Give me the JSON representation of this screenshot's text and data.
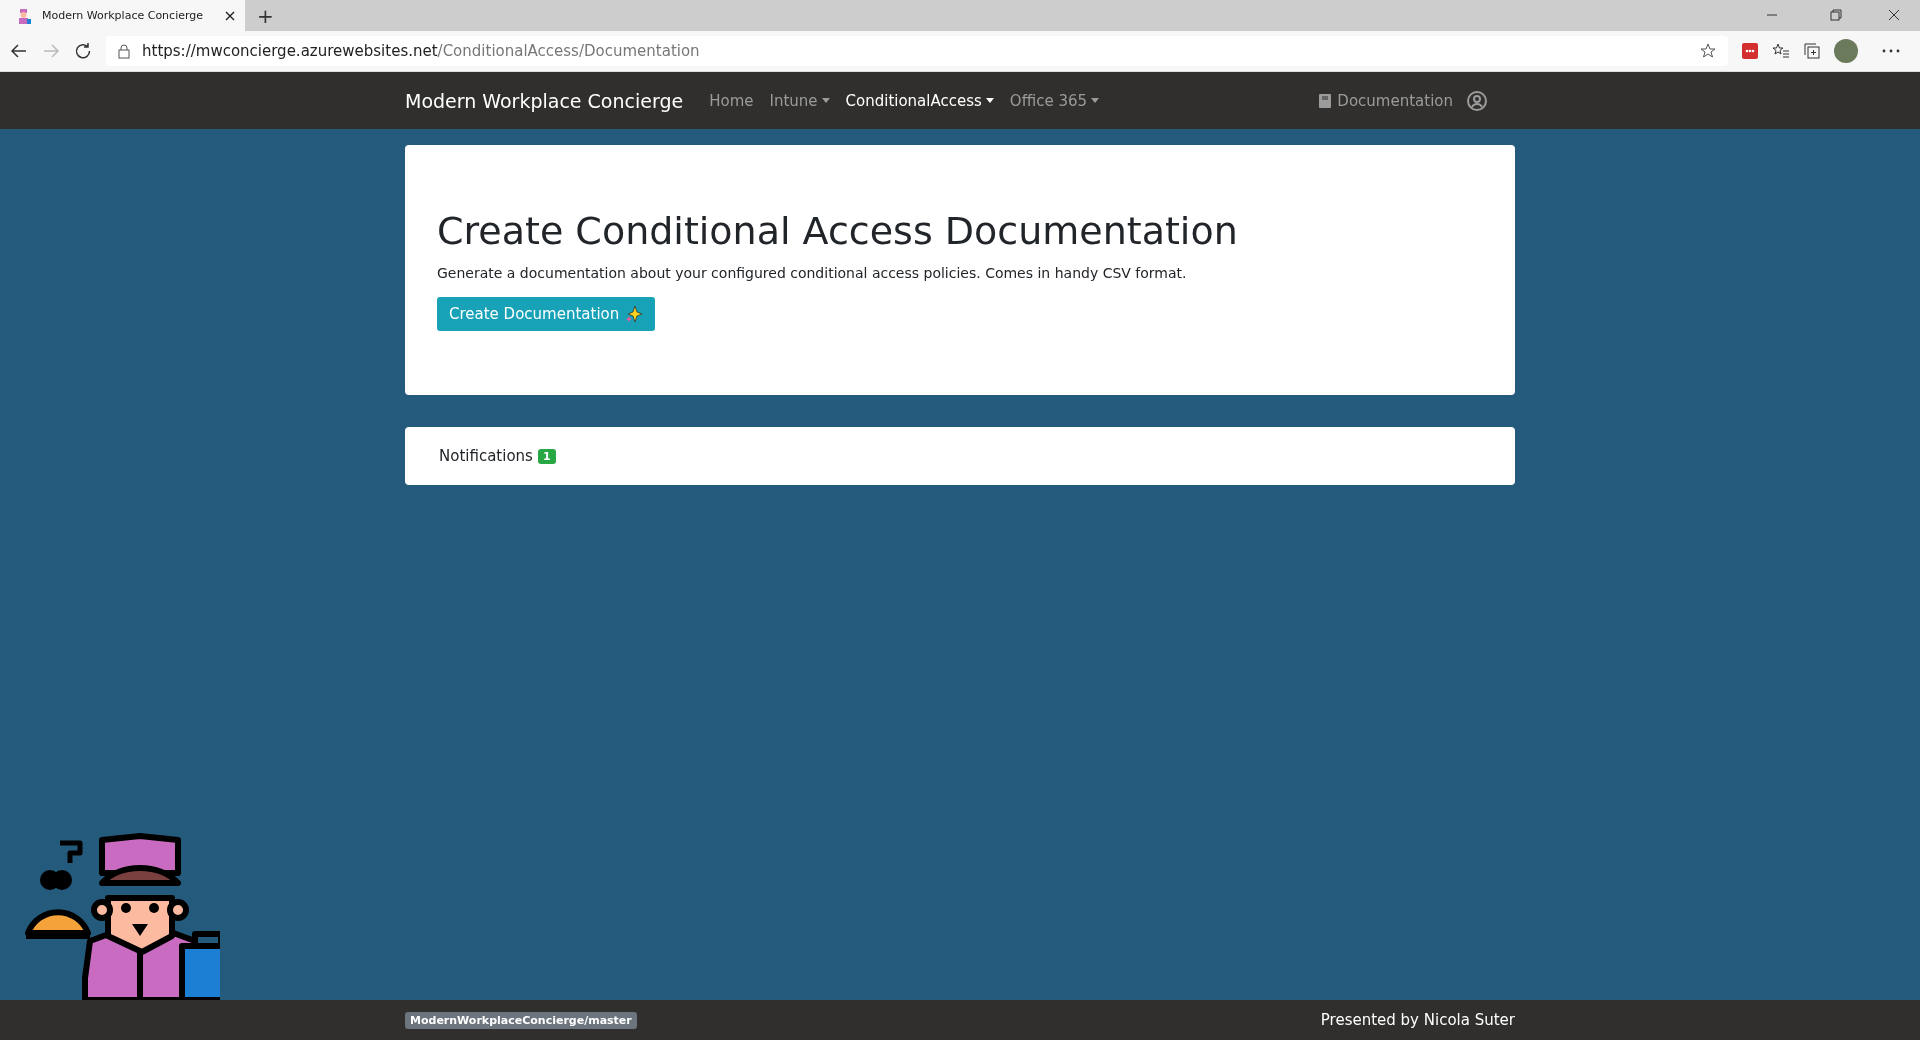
{
  "browser": {
    "tab_title": "Modern Workplace Concierge",
    "new_tab": "+",
    "url_host": "https://mwconcierge.azurewebsites.net",
    "url_path": "/ConditionalAccess/Documentation"
  },
  "navbar": {
    "brand": "Modern Workplace Concierge",
    "items": [
      {
        "label": "Home",
        "dropdown": false,
        "selected": false
      },
      {
        "label": "Intune",
        "dropdown": true,
        "selected": false
      },
      {
        "label": "ConditionalAccess",
        "dropdown": true,
        "selected": true
      },
      {
        "label": "Office 365",
        "dropdown": true,
        "selected": false
      }
    ],
    "right_link": "Documentation"
  },
  "hero": {
    "title": "Create Conditional Access Documentation",
    "description": "Generate a documentation about your configured conditional access policies. Comes in handy CSV format.",
    "button": "Create Documentation"
  },
  "notifications": {
    "label": "Notifications",
    "count": "1"
  },
  "footer": {
    "branch": "ModernWorkplaceConcierge/master",
    "credit": "Presented by Nicola Suter"
  }
}
